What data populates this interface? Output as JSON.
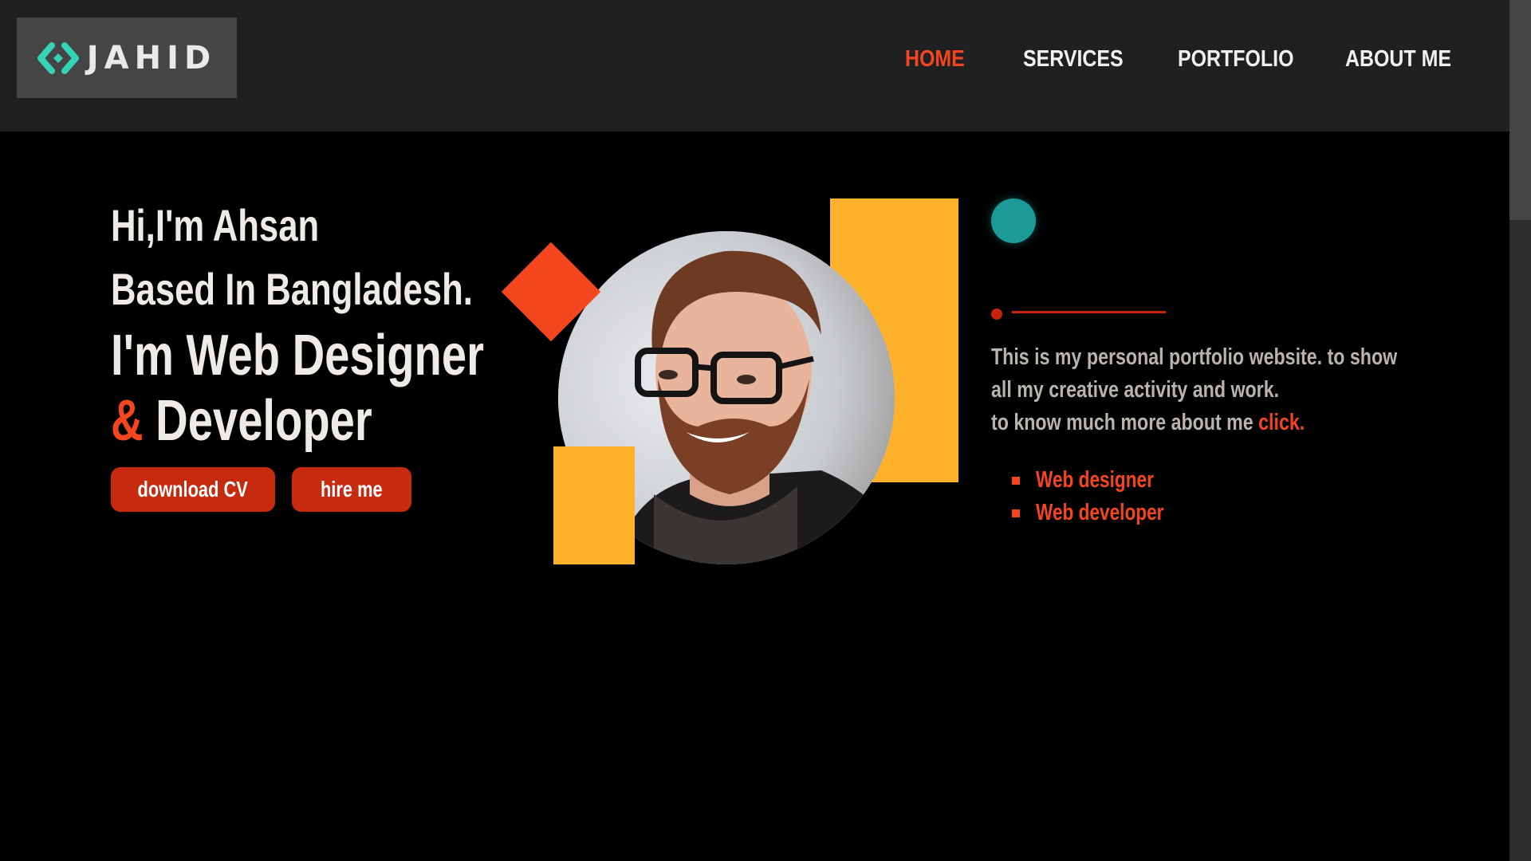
{
  "header": {
    "logo_text": "JAHID",
    "logo_icon": "code-brackets-icon",
    "logo_color": "#35d4b8",
    "nav": [
      {
        "label": "HOME",
        "active": true
      },
      {
        "label": "SERVICES",
        "active": false
      },
      {
        "label": "PORTFOLIO",
        "active": false
      },
      {
        "label": "ABOUT ME",
        "active": false
      }
    ]
  },
  "hero": {
    "greeting": "Hi,I'm Ahsan",
    "location": "Based In Bangladesh.",
    "role_line1": "I'm Web Designer",
    "role_amp": "&",
    "role_line2": "Developer",
    "buttons": {
      "download": "download CV",
      "hire": "hire me"
    }
  },
  "about": {
    "line1": "This is my personal portfolio website. to show",
    "line2": "all my creative activity and work.",
    "line3": "to know much more about me",
    "click": "click.",
    "skills": [
      "Web designer",
      "Web developer"
    ]
  },
  "colors": {
    "accent": "#f4461e",
    "button": "#c62a0f",
    "yellow": "#feb12b",
    "teal": "#1b9a98",
    "header_bg": "#1f2022"
  }
}
